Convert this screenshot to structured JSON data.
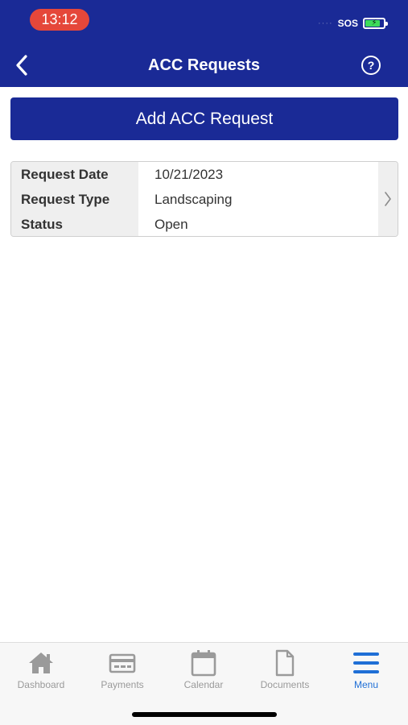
{
  "status_bar": {
    "time": "13:12",
    "signal_text": "····",
    "carrier_text": "SOS",
    "battery_symbol": "⚡"
  },
  "header": {
    "title": "ACC Requests",
    "back_icon": "chevron-left-icon",
    "help_icon": "question-circle-icon",
    "help_glyph": "?"
  },
  "actions": {
    "add_label": "Add ACC Request"
  },
  "requests": [
    {
      "fields": [
        {
          "label": "Request Date",
          "value": "10/21/2023"
        },
        {
          "label": "Request Type",
          "value": "Landscaping"
        },
        {
          "label": "Status",
          "value": "Open"
        }
      ]
    }
  ],
  "tabbar": {
    "tabs": [
      {
        "label": "Dashboard",
        "icon": "home-icon",
        "active": false
      },
      {
        "label": "Payments",
        "icon": "credit-card-icon",
        "active": false
      },
      {
        "label": "Calendar",
        "icon": "calendar-icon",
        "active": false
      },
      {
        "label": "Documents",
        "icon": "document-icon",
        "active": false
      },
      {
        "label": "Menu",
        "icon": "hamburger-menu-icon",
        "active": true
      }
    ]
  },
  "colors": {
    "brand": "#1a2a96",
    "active_tab": "#1f6fd6",
    "inactive_tab": "#9a9a9a",
    "time_pill": "#e5473a"
  }
}
